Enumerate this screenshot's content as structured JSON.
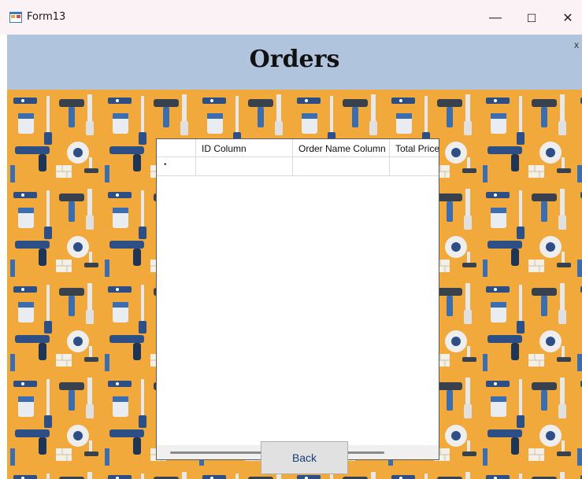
{
  "window": {
    "title": "Form13",
    "minimize": "—",
    "maximize": "☐",
    "close": "✕"
  },
  "header": {
    "title": "Orders",
    "close": "x"
  },
  "grid": {
    "columns": [
      "ID Column",
      "Order Name Column",
      "Total Price Column"
    ],
    "rows": [
      {
        "indicator": "•",
        "cells": [
          "",
          "",
          ""
        ]
      }
    ]
  },
  "back_button": {
    "label": "Back"
  },
  "colors": {
    "header_bg": "#b0c4de",
    "pattern_bg": "#f2a93b"
  }
}
